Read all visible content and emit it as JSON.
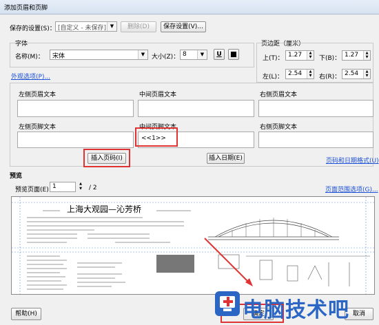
{
  "window": {
    "title": "添加页眉和页脚"
  },
  "settings": {
    "label": "保存的设置(S)：",
    "selected": "[自定义 - 未保存]",
    "delete_label": "删除(D)",
    "save_label": "保存设置(V)..."
  },
  "font": {
    "group_label": "字体",
    "name_label": "名称(M)：",
    "name_value": "宋体",
    "size_label": "大小(Z)：",
    "size_value": "8",
    "underline_label": "U"
  },
  "margins": {
    "group_label": "页边距（厘米）",
    "top_label": "上(T)：",
    "top_value": "1.27",
    "bottom_label": "下(B)：",
    "bottom_value": "1.27",
    "left_label": "左(L)：",
    "left_value": "2.54",
    "right_label": "右(R)：",
    "right_value": "2.54"
  },
  "appearance_link": "外观选项(P)...",
  "header": {
    "left_label": "左侧页眉文本",
    "center_label": "中间页眉文本",
    "right_label": "右侧页眉文本"
  },
  "footer": {
    "left_label": "左侧页脚文本",
    "center_label": "中间页脚文本",
    "right_label": "右侧页脚文本",
    "center_value": "<<1>>"
  },
  "insert": {
    "page_number_label": "插入页码(I)",
    "date_label": "插入日期(E)",
    "format_link": "页码和日期格式(U)"
  },
  "preview": {
    "group_label": "预览",
    "page_label": "预览页面(E)",
    "page_value": "1",
    "page_total": "/ 2",
    "range_link": "页面范围选项(G)...",
    "doc_title": "上海大观园—沁芳桥"
  },
  "footer_buttons": {
    "help_label": "帮助(H)",
    "ok_label": "确定",
    "cancel_label": "取消"
  },
  "watermark": {
    "text": "电脑技术吧"
  },
  "colors": {
    "accent_red": "#e03232",
    "link_blue": "#1a4fd6",
    "watermark_blue": "#2b66c4"
  }
}
